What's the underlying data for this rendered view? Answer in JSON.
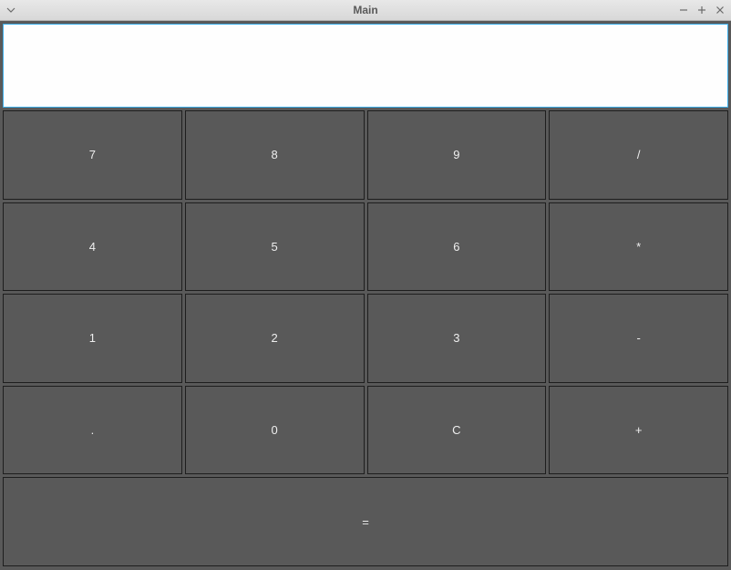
{
  "window": {
    "title": "Main"
  },
  "calculator": {
    "display_value": "",
    "keys": {
      "k7": "7",
      "k8": "8",
      "k9": "9",
      "div": "/",
      "k4": "4",
      "k5": "5",
      "k6": "6",
      "mul": "*",
      "k1": "1",
      "k2": "2",
      "k3": "3",
      "sub": "-",
      "dot": ".",
      "k0": "0",
      "clear": "C",
      "add": "+",
      "eq": "="
    }
  }
}
